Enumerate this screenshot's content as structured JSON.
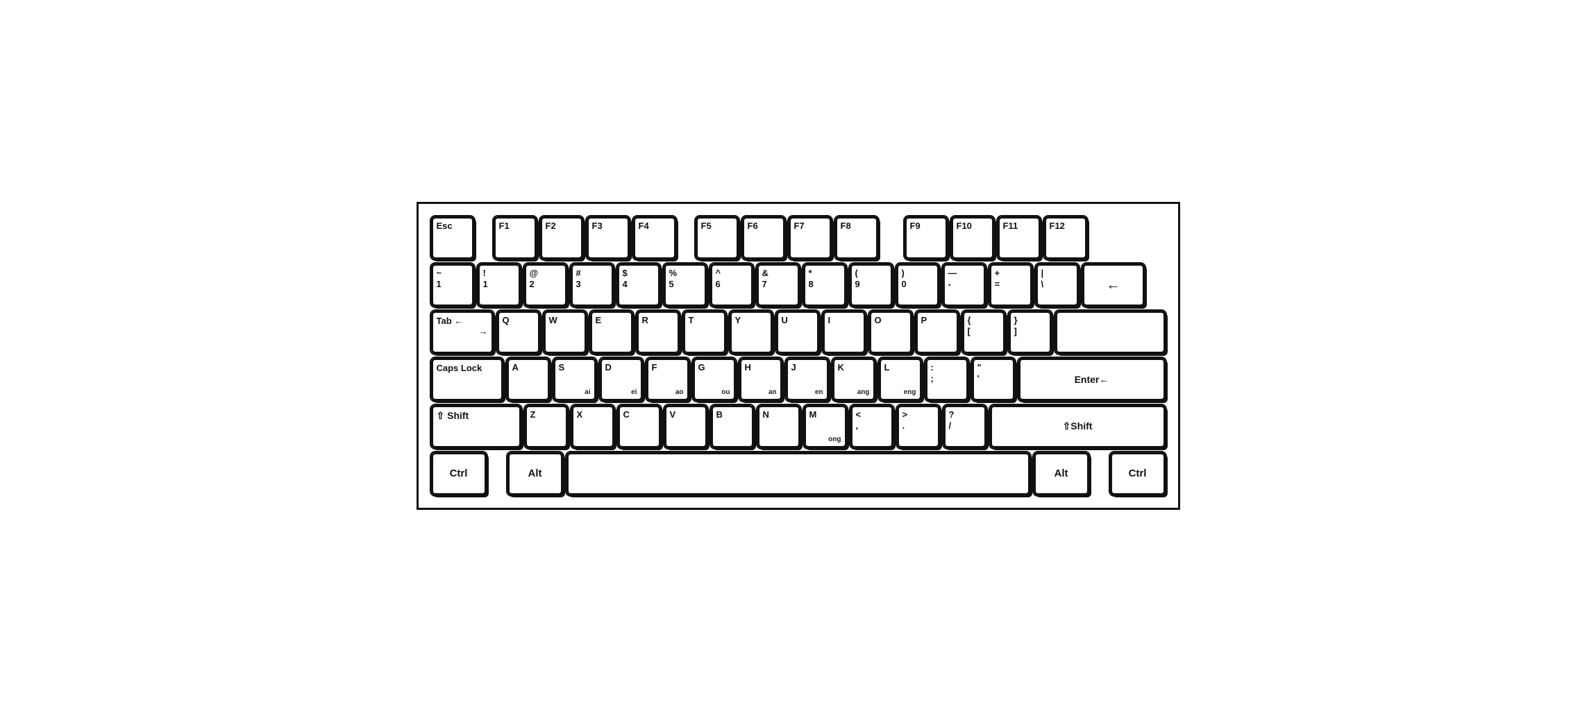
{
  "keyboard": {
    "rows": {
      "row0": {
        "keys": [
          {
            "id": "esc",
            "label": "Esc",
            "label2": "",
            "sub": "",
            "width": "62"
          },
          {
            "id": "gap1",
            "label": "",
            "label2": "",
            "sub": "",
            "width": "18",
            "spacer": true
          },
          {
            "id": "f1",
            "label": "F1",
            "label2": "",
            "sub": "",
            "width": "62"
          },
          {
            "id": "f2",
            "label": "F2",
            "label2": "",
            "sub": "",
            "width": "62"
          },
          {
            "id": "f3",
            "label": "F3",
            "label2": "",
            "sub": "",
            "width": "62"
          },
          {
            "id": "f4",
            "label": "F4",
            "label2": "",
            "sub": "",
            "width": "62"
          },
          {
            "id": "gap2",
            "label": "",
            "label2": "",
            "sub": "",
            "width": "18",
            "spacer": true
          },
          {
            "id": "f5",
            "label": "F5",
            "label2": "",
            "sub": "",
            "width": "62"
          },
          {
            "id": "f6",
            "label": "F6",
            "label2": "",
            "sub": "",
            "width": "62"
          },
          {
            "id": "f7",
            "label": "F7",
            "label2": "",
            "sub": "",
            "width": "62"
          },
          {
            "id": "f8",
            "label": "F8",
            "label2": "",
            "sub": "",
            "width": "62"
          },
          {
            "id": "gap3",
            "label": "",
            "label2": "",
            "sub": "",
            "width": "28",
            "spacer": true
          },
          {
            "id": "f9",
            "label": "F9",
            "label2": "",
            "sub": "",
            "width": "62"
          },
          {
            "id": "f10",
            "label": "F10",
            "label2": "",
            "sub": "",
            "width": "62"
          },
          {
            "id": "f11",
            "label": "F11",
            "label2": "",
            "sub": "",
            "width": "62"
          },
          {
            "id": "f12",
            "label": "F12",
            "label2": "",
            "sub": "",
            "width": "62"
          }
        ]
      },
      "row1": {
        "keys": [
          {
            "id": "tilde",
            "top": "~",
            "bot": "1",
            "sub": ""
          },
          {
            "id": "excl",
            "top": "!",
            "bot": "1",
            "sub": ""
          },
          {
            "id": "at",
            "top": "@",
            "bot": "2",
            "sub": ""
          },
          {
            "id": "hash",
            "top": "#",
            "bot": "3",
            "sub": ""
          },
          {
            "id": "dollar",
            "top": "$",
            "bot": "4",
            "sub": ""
          },
          {
            "id": "percent",
            "top": "%",
            "bot": "5",
            "sub": ""
          },
          {
            "id": "caret",
            "top": "^",
            "bot": "6",
            "sub": ""
          },
          {
            "id": "amp",
            "top": "&",
            "bot": "7",
            "sub": ""
          },
          {
            "id": "star",
            "top": "*",
            "bot": "8",
            "sub": ""
          },
          {
            "id": "lparen",
            "top": "(",
            "bot": "9",
            "sub": ""
          },
          {
            "id": "rparen",
            "top": ")",
            "bot": "0",
            "sub": ""
          },
          {
            "id": "dash",
            "top": "—",
            "bot": "-",
            "sub": ""
          },
          {
            "id": "plus",
            "top": "+",
            "bot": "=",
            "sub": ""
          },
          {
            "id": "pipe",
            "top": "|",
            "bot": "\\",
            "sub": ""
          },
          {
            "id": "backspace",
            "top": "←",
            "bot": "",
            "sub": "",
            "wide": true
          }
        ]
      },
      "row2": {
        "tab": {
          "label": "Tab ←→",
          "width": "90"
        },
        "keys": [
          {
            "id": "q",
            "label": "Q",
            "sub": ""
          },
          {
            "id": "w",
            "label": "W",
            "sub": ""
          },
          {
            "id": "e",
            "label": "E",
            "sub": ""
          },
          {
            "id": "r",
            "label": "R",
            "sub": ""
          },
          {
            "id": "t",
            "label": "T",
            "sub": ""
          },
          {
            "id": "y",
            "label": "Y",
            "sub": ""
          },
          {
            "id": "u",
            "label": "U",
            "sub": ""
          },
          {
            "id": "i",
            "label": "I",
            "sub": ""
          },
          {
            "id": "o",
            "label": "O",
            "sub": ""
          },
          {
            "id": "p",
            "label": "P",
            "sub": ""
          },
          {
            "id": "lbrace",
            "top": "{",
            "bot": "[",
            "sub": ""
          },
          {
            "id": "rbrace",
            "top": "}",
            "bot": "]",
            "sub": ""
          }
        ]
      },
      "row3": {
        "caps": {
          "label": "Caps Lock",
          "width": "104"
        },
        "keys": [
          {
            "id": "a",
            "label": "A",
            "sub": ""
          },
          {
            "id": "s",
            "label": "S",
            "sub": "ai"
          },
          {
            "id": "d",
            "label": "D",
            "sub": "ei"
          },
          {
            "id": "f",
            "label": "F",
            "sub": "ao"
          },
          {
            "id": "g",
            "label": "G",
            "sub": "ou"
          },
          {
            "id": "h",
            "label": "H",
            "sub": "an"
          },
          {
            "id": "j",
            "label": "J",
            "sub": "en"
          },
          {
            "id": "k",
            "label": "K",
            "sub": "ang"
          },
          {
            "id": "l",
            "label": "L",
            "sub": "eng"
          },
          {
            "id": "colon",
            "top": ":",
            "bot": ";",
            "sub": ""
          },
          {
            "id": "quote",
            "top": "\"",
            "bot": "'",
            "sub": ""
          }
        ],
        "enter": {
          "label": "Enter←",
          "width": "110"
        }
      },
      "row4": {
        "shiftl": {
          "label": "⇧ Shift",
          "width": "130"
        },
        "keys": [
          {
            "id": "z",
            "label": "Z",
            "sub": ""
          },
          {
            "id": "x",
            "label": "X",
            "sub": ""
          },
          {
            "id": "c",
            "label": "C",
            "sub": ""
          },
          {
            "id": "v",
            "label": "V",
            "sub": ""
          },
          {
            "id": "b",
            "label": "B",
            "sub": ""
          },
          {
            "id": "n",
            "label": "N",
            "sub": ""
          },
          {
            "id": "m",
            "label": "M",
            "sub": "ong"
          },
          {
            "id": "lt",
            "top": "<",
            "bot": ",",
            "sub": ""
          },
          {
            "id": "gt",
            "top": ">",
            "bot": ".",
            "sub": ""
          },
          {
            "id": "question",
            "top": "?",
            "bot": "/",
            "sub": ""
          }
        ],
        "shiftr": {
          "label": "⇧Shift",
          "width": "130"
        }
      },
      "row5": {
        "ctrll": {
          "label": "Ctrl",
          "width": "80"
        },
        "gap": {
          "width": "20",
          "spacer": true
        },
        "altl": {
          "label": "Alt",
          "width": "80"
        },
        "space": {
          "label": "",
          "width": "350"
        },
        "altr": {
          "label": "Alt",
          "width": "80"
        },
        "gap2": {
          "width": "20",
          "spacer": true
        },
        "ctrlr": {
          "label": "Ctrl",
          "width": "80"
        }
      }
    }
  }
}
